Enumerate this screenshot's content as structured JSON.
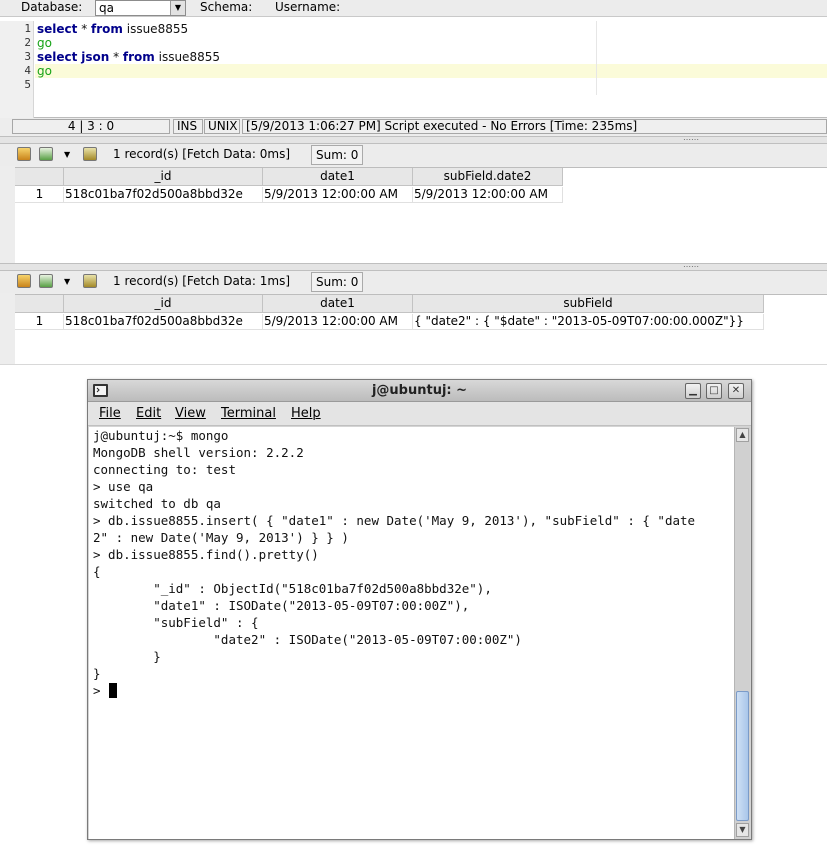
{
  "toolbar": {
    "database_label": "Database:",
    "database_value": "qa",
    "schema_label": "Schema:",
    "username_label": "Username:"
  },
  "editor": {
    "lines": [
      {
        "n": "1",
        "segments": [
          {
            "t": "select",
            "c": "kw"
          },
          {
            "t": " * ",
            "c": "plain"
          },
          {
            "t": "from",
            "c": "kw"
          },
          {
            "t": " issue8855",
            "c": "plain"
          }
        ]
      },
      {
        "n": "2",
        "segments": [
          {
            "t": "go",
            "c": "go"
          }
        ]
      },
      {
        "n": "3",
        "segments": [
          {
            "t": "select",
            "c": "kw"
          },
          {
            "t": " ",
            "c": "plain"
          },
          {
            "t": "json",
            "c": "kw"
          },
          {
            "t": " * ",
            "c": "plain"
          },
          {
            "t": "from",
            "c": "kw"
          },
          {
            "t": " issue8855",
            "c": "plain"
          }
        ]
      },
      {
        "n": "4",
        "segments": [
          {
            "t": "go",
            "c": "go"
          }
        ]
      },
      {
        "n": "5",
        "segments": []
      }
    ]
  },
  "status": {
    "position": "4 | 3 : 0",
    "mode": "INS",
    "line_ending": "UNIX",
    "message": "[5/9/2013 1:06:27 PM] Script executed - No Errors [Time: 235ms]"
  },
  "results": [
    {
      "records": "1 record(s) [Fetch Data: 0ms]",
      "sum": "Sum: 0",
      "columns": [
        "_id",
        "date1",
        "subField.date2"
      ],
      "rows": [
        {
          "n": "1",
          "cells": [
            "518c01ba7f02d500a8bbd32e",
            "5/9/2013 12:00:00 AM",
            "5/9/2013 12:00:00 AM"
          ]
        }
      ]
    },
    {
      "records": "1 record(s) [Fetch Data: 1ms]",
      "sum": "Sum: 0",
      "columns": [
        "_id",
        "date1",
        "subField"
      ],
      "rows": [
        {
          "n": "1",
          "cells": [
            "518c01ba7f02d500a8bbd32e",
            "5/9/2013 12:00:00 AM",
            "{ \"date2\" : { \"$date\" : \"2013-05-09T07:00:00.000Z\"}}"
          ]
        }
      ]
    }
  ],
  "terminal": {
    "title": "j@ubuntuj: ~",
    "menu": [
      "File",
      "Edit",
      "View",
      "Terminal",
      "Help"
    ],
    "lines": [
      "j@ubuntuj:~$ mongo",
      "MongoDB shell version: 2.2.2",
      "connecting to: test",
      "> use qa",
      "switched to db qa",
      "> db.issue8855.insert( { \"date1\" : new Date('May 9, 2013'), \"subField\" : { \"date",
      "2\" : new Date('May 9, 2013') } } )",
      "> db.issue8855.find().pretty()",
      "{",
      "        \"_id\" : ObjectId(\"518c01ba7f02d500a8bbd32e\"),",
      "        \"date1\" : ISODate(\"2013-05-09T07:00:00Z\"),",
      "        \"subField\" : {",
      "                \"date2\" : ISODate(\"2013-05-09T07:00:00Z\")",
      "        }",
      "}",
      "> "
    ]
  },
  "colors": {
    "keyword": "#00008b",
    "go": "#17a317",
    "current_line": "#fbfbd9",
    "scroll_thumb": "#a9c6ea"
  },
  "icons": [
    "terminal-app-icon",
    "minimize-icon",
    "maximize-icon",
    "close-icon",
    "export-icon",
    "excel-icon",
    "dropdown-arrow-icon",
    "refresh-icon",
    "scroll-up-icon",
    "scroll-down-icon"
  ]
}
